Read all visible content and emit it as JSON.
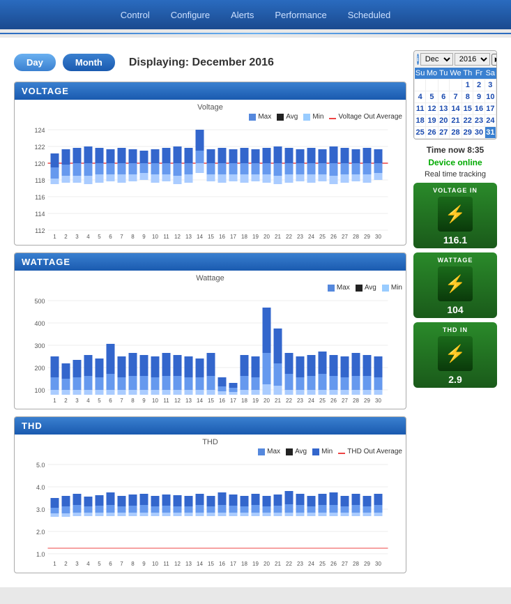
{
  "nav": {
    "items": [
      "Control",
      "Configure",
      "Alerts",
      "Performance",
      "Scheduled"
    ]
  },
  "controls": {
    "day_label": "Day",
    "month_label": "Month",
    "displaying_prefix": "Displaying:",
    "displaying_period": "December 2016"
  },
  "calendar": {
    "month_value": "Dec",
    "year_value": "2016",
    "info_icon": "i",
    "day_headers": [
      "Su",
      "Mo",
      "Tu",
      "We",
      "Th",
      "Fr",
      "Sa"
    ],
    "weeks": [
      [
        "",
        "",
        "",
        "",
        "1",
        "2",
        "3"
      ],
      [
        "4",
        "5",
        "6",
        "7",
        "8",
        "9",
        "10"
      ],
      [
        "11",
        "12",
        "13",
        "14",
        "15",
        "16",
        "17"
      ],
      [
        "18",
        "19",
        "20",
        "21",
        "22",
        "23",
        "24"
      ],
      [
        "25",
        "26",
        "27",
        "28",
        "29",
        "30",
        "31"
      ]
    ],
    "today": "31"
  },
  "status": {
    "time_label": "Time now 8:35",
    "online_label": "Device online",
    "realtime_label": "Real time tracking"
  },
  "metrics": [
    {
      "title": "VOLTAGE IN",
      "icon": "⚡",
      "value": "116.1"
    },
    {
      "title": "WATTAGE",
      "icon": "⚡",
      "value": "104"
    },
    {
      "title": "THD IN",
      "icon": "⚡",
      "value": "2.9"
    }
  ],
  "voltage_chart": {
    "title": "Voltage",
    "section_title": "Voltage",
    "legend": [
      {
        "label": "Max",
        "color": "#5588dd"
      },
      {
        "label": "Avg",
        "color": "#222222"
      },
      {
        "label": "Min",
        "color": "#99ccff"
      },
      {
        "label": "Voltage Out Average",
        "color": "#ee4444"
      }
    ],
    "y_max": 124,
    "y_min": 112,
    "avg_line": 120
  },
  "wattage_chart": {
    "title": "Wattage",
    "section_title": "Wattage",
    "legend": [
      {
        "label": "Max",
        "color": "#5588dd"
      },
      {
        "label": "Avg",
        "color": "#222222"
      },
      {
        "label": "Min",
        "color": "#99ccff"
      }
    ],
    "y_max": 500,
    "y_min": 0
  },
  "thd_chart": {
    "title": "THD",
    "section_title": "THD",
    "legend": [
      {
        "label": "Max",
        "color": "#5588dd"
      },
      {
        "label": "Avg",
        "color": "#222222"
      },
      {
        "label": "Min",
        "color": "#3366cc"
      },
      {
        "label": "THD Out Average",
        "color": "#ee4444"
      }
    ],
    "y_max": 5.0,
    "y_min": 1.0
  }
}
